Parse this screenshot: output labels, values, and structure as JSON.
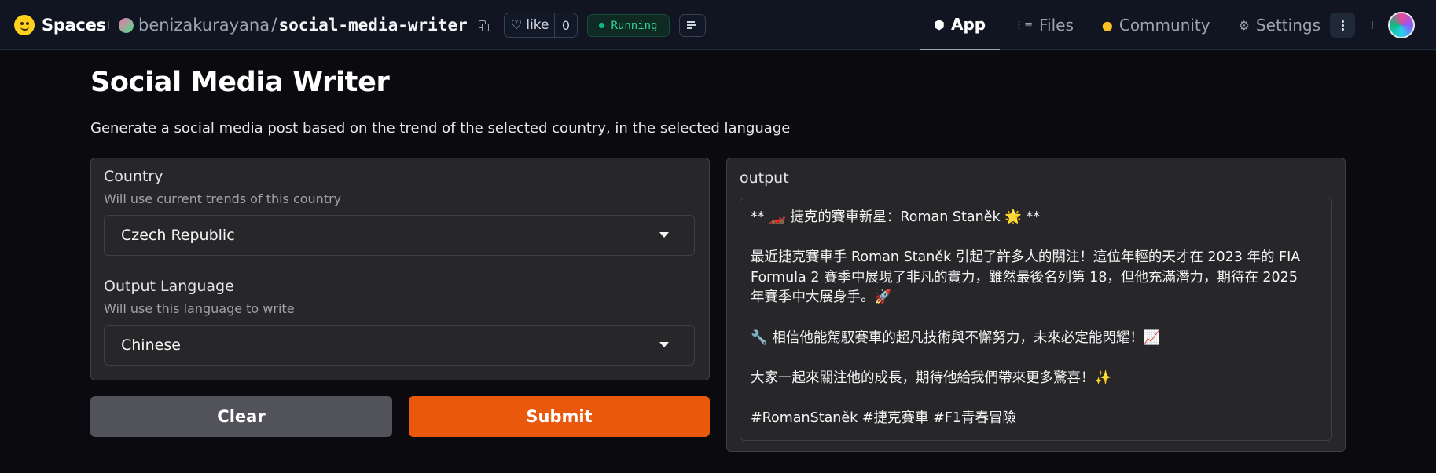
{
  "topbar": {
    "brand": "Spaces",
    "owner": "benizakurayana",
    "separator": "/",
    "repo": "social-media-writer",
    "like_label": "like",
    "like_count": "0",
    "status": "Running",
    "status_color": "#34d399",
    "nav": [
      {
        "label": "App",
        "icon": "cube-icon",
        "glyph": "⬢"
      },
      {
        "label": "Files",
        "icon": "files-icon",
        "glyph": "⋮≡"
      },
      {
        "label": "Community",
        "icon": "community-icon",
        "glyph": "●"
      },
      {
        "label": "Settings",
        "icon": "gear-icon",
        "glyph": "⚙"
      }
    ]
  },
  "app": {
    "title": "Social Media Writer",
    "description": "Generate a social media post based on the trend of the selected country, in the selected language",
    "country": {
      "label": "Country",
      "info": "Will use current trends of this country",
      "value": "Czech Republic"
    },
    "language": {
      "label": "Output Language",
      "info": "Will use this language to write",
      "value": "Chinese"
    },
    "clear_label": "Clear",
    "submit_label": "Submit",
    "submit_color": "#ea580c",
    "output": {
      "label": "output",
      "lines": [
        "** 🏎️ 捷克的賽車新星：Roman Staněk 🌟 **",
        "",
        "最近捷克賽車手 Roman Staněk 引起了許多人的關注！這位年輕的天才在 2023 年的 FIA",
        "Formula 2 賽季中展現了非凡的實力，雖然最後名列第 18，但他充滿潛力，期待在 2025",
        "年賽季中大展身手。🚀",
        "",
        "🔧 相信他能駕馭賽車的超凡技術與不懈努力，未來必定能閃耀！📈",
        "",
        "大家一起來關注他的成長，期待他給我們帶來更多驚喜！✨",
        "",
        "#RomanStaněk #捷克賽車 #F1青春冒險"
      ]
    }
  }
}
